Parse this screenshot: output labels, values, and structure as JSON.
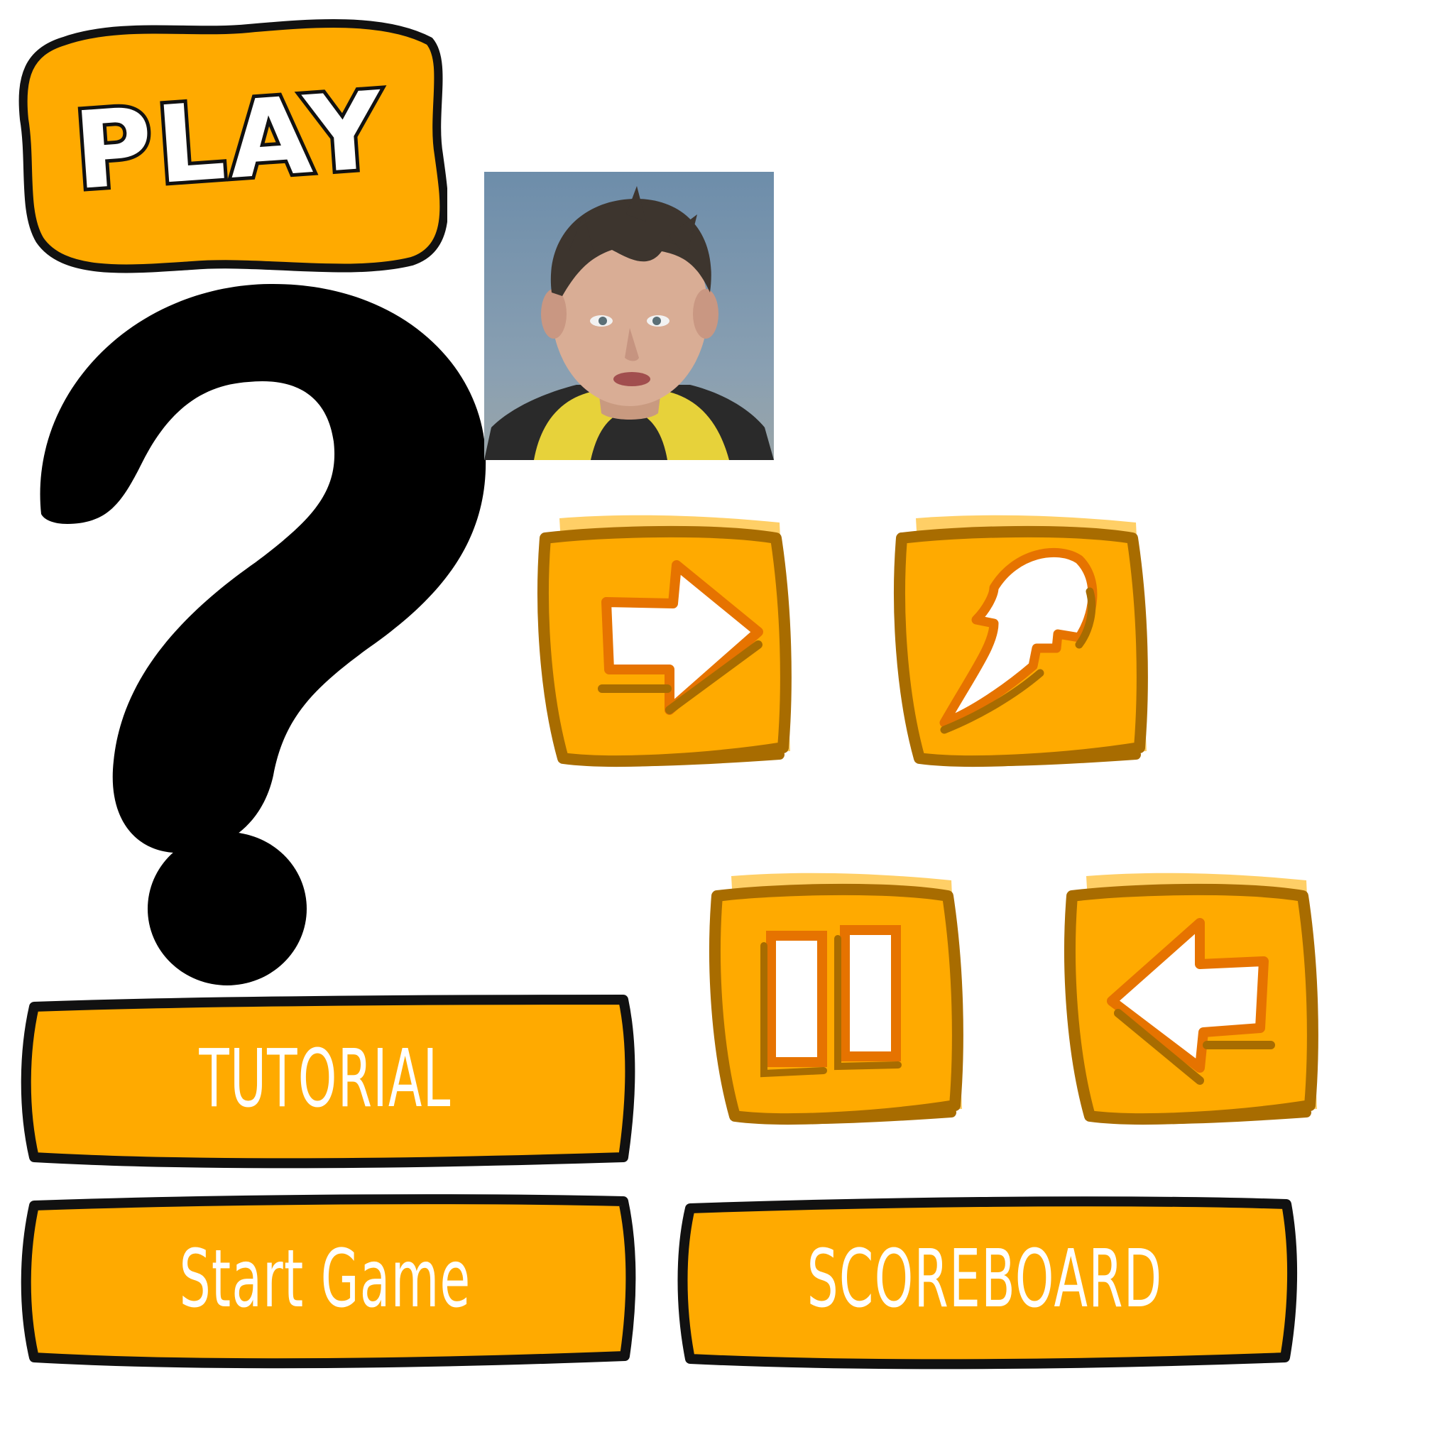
{
  "title_badge": {
    "label": "PLAY"
  },
  "help_icon": {
    "name": "question-mark-icon"
  },
  "player": {
    "photo_alt": "player photo"
  },
  "icon_buttons": [
    {
      "name": "next-button",
      "icon": "arrow-right-icon"
    },
    {
      "name": "boost-button",
      "icon": "flame-icon"
    },
    {
      "name": "pause-button",
      "icon": "pause-icon"
    },
    {
      "name": "back-button",
      "icon": "arrow-left-icon"
    }
  ],
  "menu": {
    "tutorial": "TUTORIAL",
    "start_game": "Start Game",
    "scoreboard": "SCOREBOARD"
  },
  "colors": {
    "button_fill": "#FFAA00",
    "button_shadow": "#A86C00",
    "button_highlight": "#FFCF66",
    "icon_stroke": "#E67300",
    "outline": "#111111",
    "label": "#FFFFFF"
  }
}
